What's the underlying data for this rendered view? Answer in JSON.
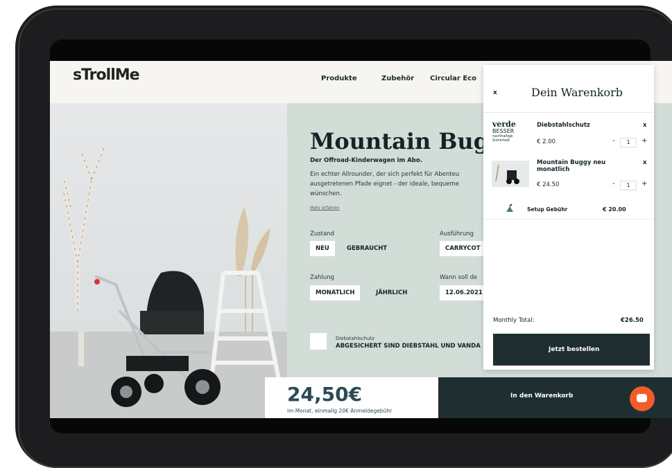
{
  "header": {
    "logo": "sTrollMe",
    "nav": [
      "Produkte",
      "Zubehör",
      "Circular Eco"
    ]
  },
  "product": {
    "title": "Mountain Bugg",
    "subtitle": "Der Offroad-Kinderwagen im Abo.",
    "description": "Ein echter Allrounder, der sich perfekt für Abenteu ausgetretenen Pfade eignet - der ideale, bequeme wünschen.",
    "more_link": "Mehr erfahren",
    "zustand": {
      "label": "Zustand",
      "options": [
        "NEU",
        "GEBRAUCHT"
      ],
      "selected": "NEU"
    },
    "ausfuehrung": {
      "label": "Ausführung",
      "value": "CARRYCOT"
    },
    "zahlung": {
      "label": "Zahlung",
      "options": [
        "MONATLICH",
        "JÄHRLICH"
      ],
      "selected": "MONATLICH"
    },
    "wann": {
      "label": "Wann soll de",
      "value": "12.06.2021"
    },
    "diebstahl": {
      "label": "Diebstahlschutz",
      "text": "ABGESICHERT SIND DIEBSTAHL UND VANDA"
    },
    "price": "24,50€",
    "price_sub": "im Monat, einmalig 20€ Anmeldegebühr",
    "cta": "In den Warenkorb"
  },
  "cart": {
    "close": "x",
    "title": "Dein Warenkorb",
    "items": [
      {
        "brand_top": "verde",
        "brand_mid": "BESSER",
        "brand_bottom": "nachhaltige Sicherheit",
        "name": "Diebstahlschutz",
        "price": "€ 2.00",
        "qty": "1",
        "remove": "x",
        "minus": "-",
        "plus": "+"
      },
      {
        "name": "Mountain Buggy neu monatlich",
        "price": "€ 24.50",
        "qty": "1",
        "remove": "x",
        "minus": "-",
        "plus": "+"
      }
    ],
    "setup": {
      "label": "Setup Gebühr",
      "price": "€ 20.00"
    },
    "total_label": "Monthly Total:",
    "total_value": "€26.50",
    "order_button": "Jetzt bestellen"
  },
  "colors": {
    "dark": "#1f2e31",
    "sage": "#d3ddd8",
    "accent": "#f25c2a",
    "price": "#2c4a55"
  },
  "icons": [
    "chat-icon",
    "plant-icon"
  ]
}
